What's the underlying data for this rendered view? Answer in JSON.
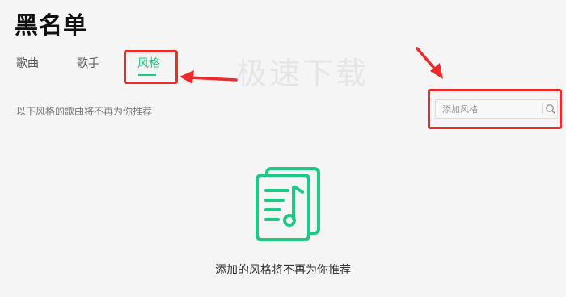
{
  "page": {
    "title": "黑名单"
  },
  "tabs": [
    {
      "label": "歌曲",
      "active": false
    },
    {
      "label": "歌手",
      "active": false
    },
    {
      "label": "风格",
      "active": true
    }
  ],
  "watermark": "极速下载",
  "hint": "以下风格的歌曲将不再为你推荐",
  "search": {
    "placeholder": "添加风格",
    "value": "",
    "icon": "search-icon"
  },
  "empty_state": {
    "icon": "music-document-icon",
    "message": "添加的风格将不再为你推荐"
  },
  "colors": {
    "accent": "#1ec986",
    "annotation": "#ee2b2b",
    "background": "#f5f5f5"
  }
}
